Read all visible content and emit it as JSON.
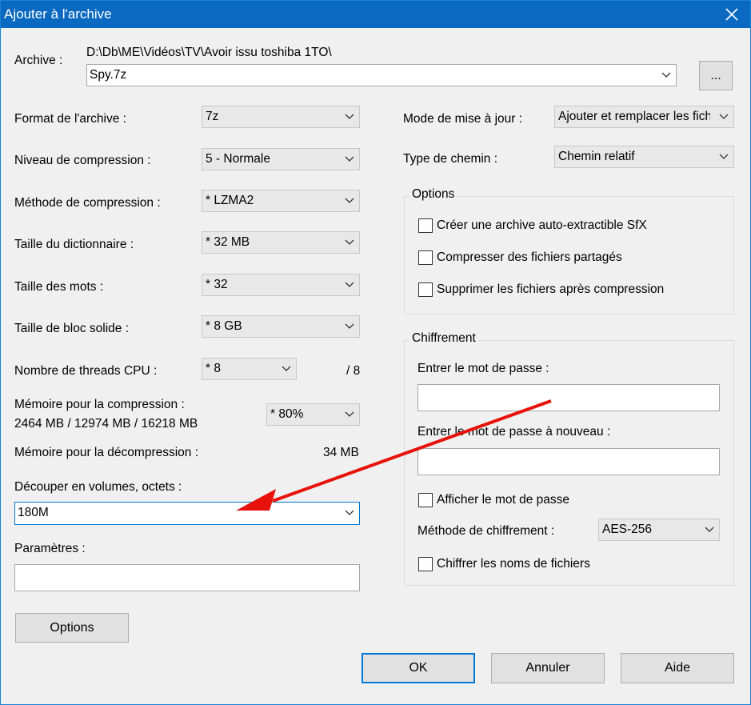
{
  "window": {
    "title": "Ajouter à l'archive"
  },
  "archive": {
    "label": "Archive :",
    "path": "D:\\Db\\ME\\Vidéos\\TV\\Avoir issu toshiba 1TO\\",
    "name": "Spy.7z",
    "browse_label": "..."
  },
  "left": {
    "format_label": "Format de l'archive :",
    "format_value": "7z",
    "level_label": "Niveau de compression :",
    "level_value": "5 - Normale",
    "method_label": "Méthode de compression :",
    "method_value": "*  LZMA2",
    "dict_label": "Taille du dictionnaire :",
    "dict_value": "*  32 MB",
    "word_label": "Taille des mots :",
    "word_value": "*  32",
    "solid_label": "Taille de bloc solide :",
    "solid_value": "*  8 GB",
    "threads_label": "Nombre de threads CPU :",
    "threads_value": "*  8",
    "threads_max": "/ 8",
    "mem_comp_label": "Mémoire pour la compression :",
    "mem_comp_detail": "2464 MB / 12974 MB / 16218 MB",
    "mem_comp_value": "*  80%",
    "mem_decomp_label": "Mémoire pour la décompression :",
    "mem_decomp_value": "34 MB",
    "split_label": "Découper en volumes, octets :",
    "split_value": "180M",
    "params_label": "Paramètres :",
    "params_value": "",
    "options_button": "Options"
  },
  "right": {
    "update_label": "Mode de mise à jour :",
    "update_value": "Ajouter et remplacer les fich",
    "path_label": "Type de chemin :",
    "path_value": "Chemin relatif",
    "options_group": "Options",
    "opt_sfx": "Créer une archive auto-extractible SfX",
    "opt_shared": "Compresser des fichiers partagés",
    "opt_delete": "Supprimer les fichiers après compression",
    "enc_group": "Chiffrement",
    "pwd_label": "Entrer le mot de passe :",
    "pwd2_label": "Entrer le mot de passe à nouveau :",
    "show_pwd": "Afficher le mot de passe",
    "enc_method_label": "Méthode de chiffrement :",
    "enc_method_value": "AES-256",
    "enc_names": "Chiffrer les noms de fichiers"
  },
  "buttons": {
    "ok": "OK",
    "cancel": "Annuler",
    "help": "Aide"
  },
  "annotation": {
    "arrow_color": "#e8120c"
  }
}
